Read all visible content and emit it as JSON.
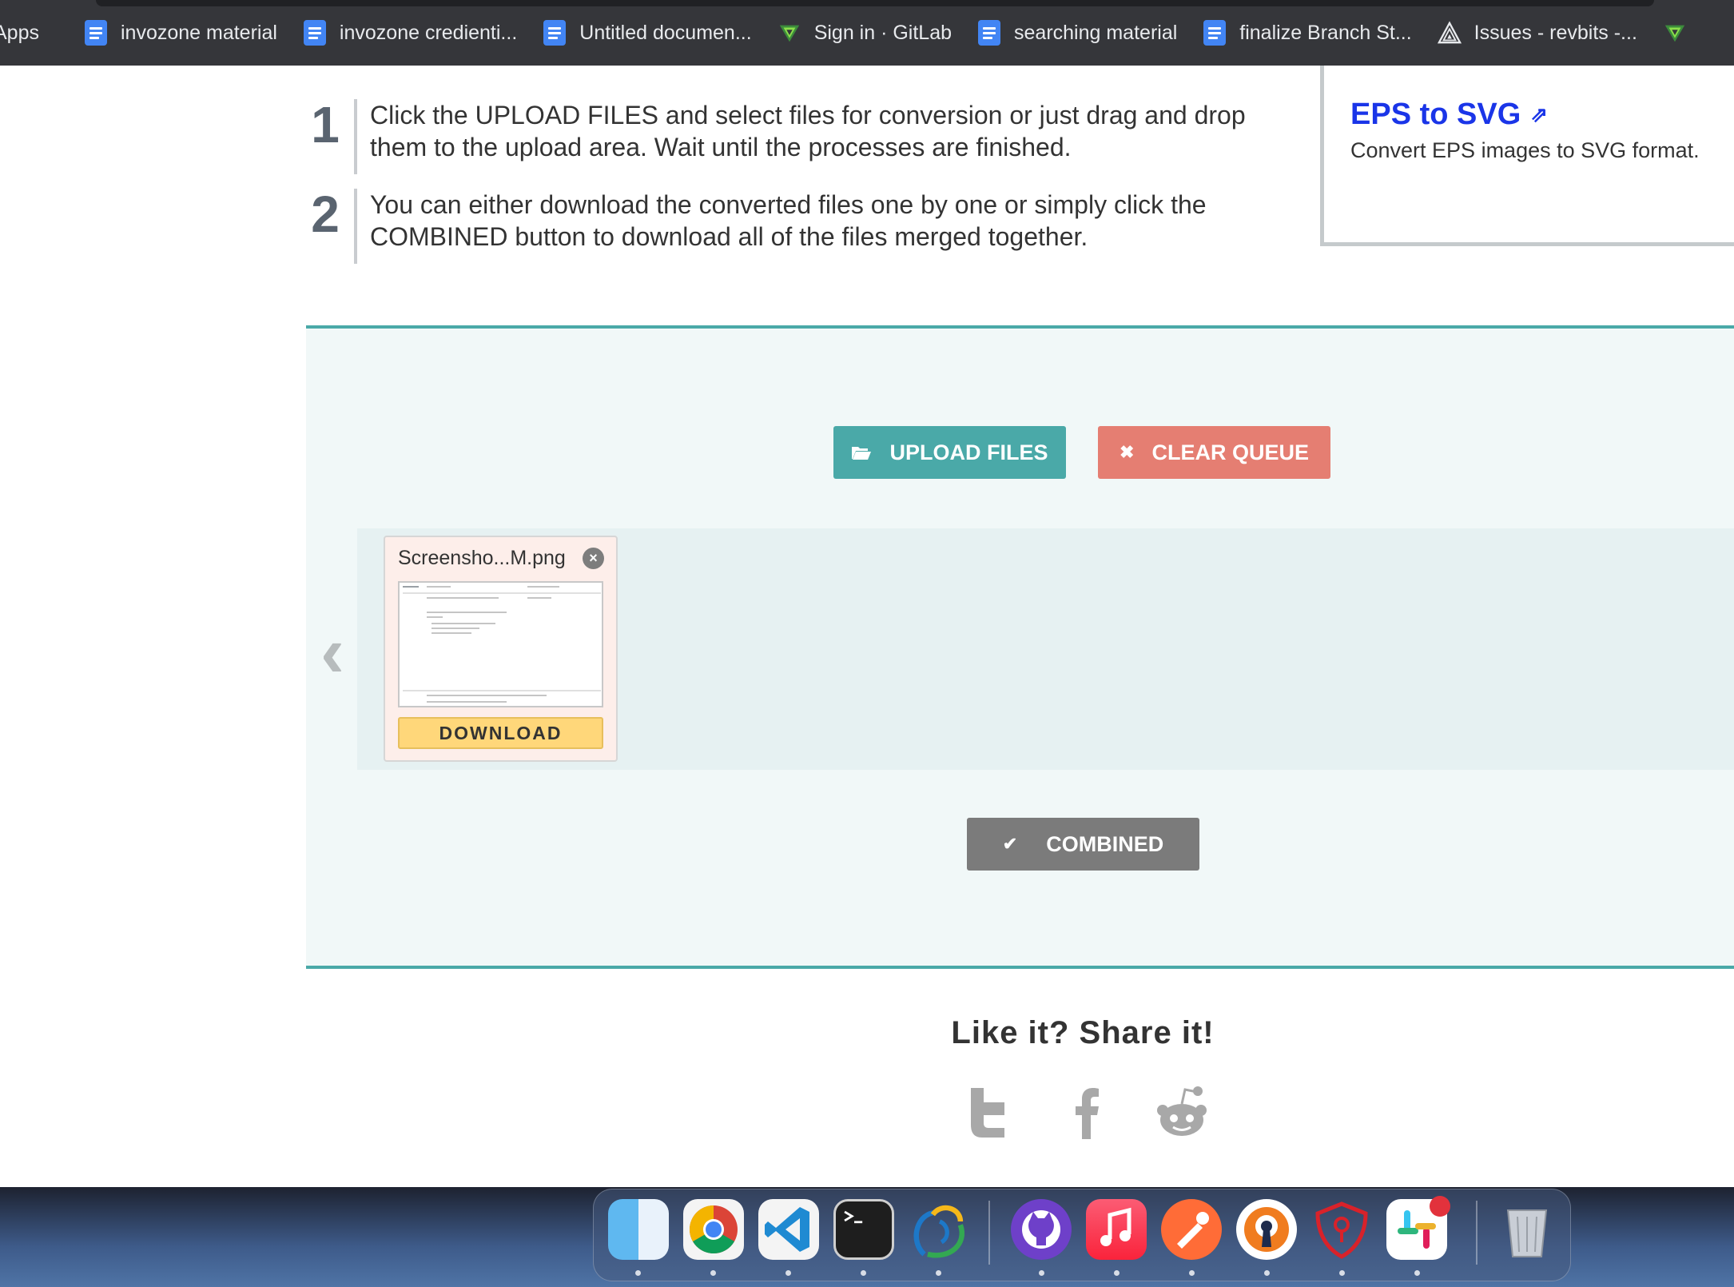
{
  "bookmarks": [
    {
      "label": "Apps",
      "icon": "apps-grid-icon"
    },
    {
      "label": "invozone material",
      "icon": "google-doc-icon"
    },
    {
      "label": "invozone credienti...",
      "icon": "google-doc-icon"
    },
    {
      "label": "Untitled documen...",
      "icon": "google-doc-icon"
    },
    {
      "label": "Sign in · GitLab",
      "icon": "gitlab-icon"
    },
    {
      "label": "searching material",
      "icon": "google-doc-icon"
    },
    {
      "label": "finalize Branch St...",
      "icon": "google-doc-icon"
    },
    {
      "label": "Issues - revbits -...",
      "icon": "issues-icon"
    }
  ],
  "steps": [
    {
      "num": "1",
      "text": "Click the UPLOAD FILES and select files for conversion or just drag and drop them to the upload area. Wait until the processes are finished."
    },
    {
      "num": "2",
      "text": "You can either download the converted files one by one or simply click the COMBINED button to download all of the files merged together."
    }
  ],
  "side_card": {
    "title": "EPS to SVG",
    "arrow": "⇗",
    "desc": "Convert EPS images to SVG format."
  },
  "buttons": {
    "upload": "UPLOAD FILES",
    "clear": "CLEAR QUEUE",
    "combined": "COMBINED",
    "download": "DOWNLOAD"
  },
  "file": {
    "name": "Screensho...M.png"
  },
  "share": {
    "title": "Like it? Share it!"
  },
  "dock": [
    "Finder",
    "Chrome",
    "VS Code",
    "Terminal",
    "Elementor",
    "GitHub Desktop",
    "Music",
    "Postman",
    "OpenVPN",
    "Bitwarden",
    "Slack",
    "Trash"
  ],
  "colors": {
    "accent": "#4aa9a8",
    "clear": "#e57e72",
    "link": "#1a35e8",
    "combined": "#7b7b7b",
    "download": "#ffd77a"
  }
}
